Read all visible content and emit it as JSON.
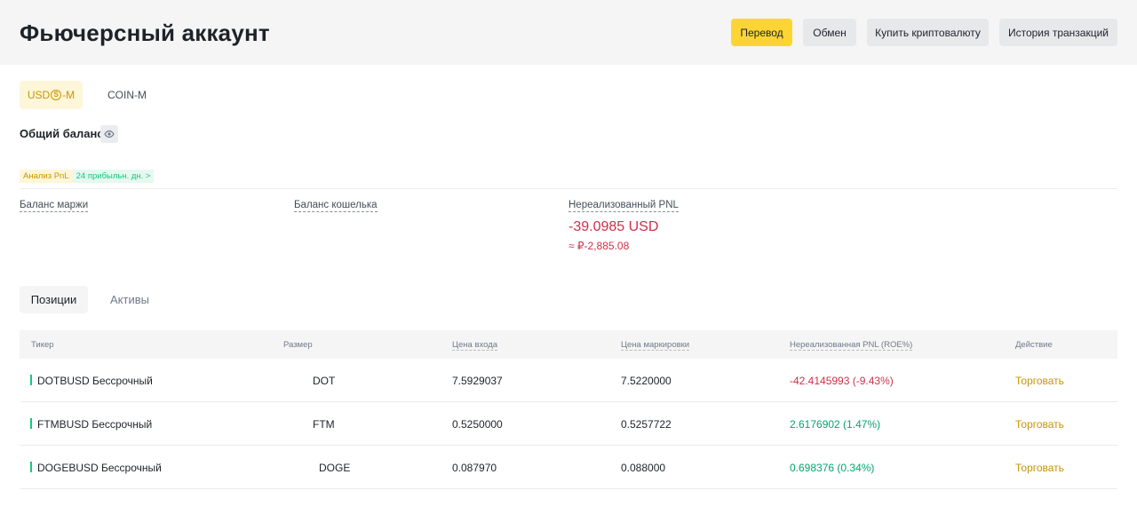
{
  "header": {
    "title": "Фьючерсный аккаунт",
    "buttons": {
      "transfer": "Перевод",
      "exchange": "Обмен",
      "buy_crypto": "Купить криптовалюту",
      "history": "История транзакций"
    }
  },
  "account_tabs": {
    "usd_pre": "USD",
    "usd_coin_glyph": "S",
    "usd_post": "-M",
    "coin": "COIN-M"
  },
  "balance": {
    "label": "Общий баланс",
    "pnl_analysis": "Анализ PnL",
    "profit_days": "24 прибыльн. дн. >"
  },
  "stats": {
    "margin_balance": "Баланс маржи",
    "wallet_balance": "Баланс кошелька",
    "unrealized_pnl": "Нереализованный PNL",
    "unrealized_value": "-39.0985 USD",
    "unrealized_approx": "≈ ₽-2,885.08"
  },
  "position_tabs": {
    "positions": "Позиции",
    "assets": "Активы"
  },
  "table": {
    "headers": {
      "ticker": "Тикер",
      "size": "Размер",
      "entry_price": "Цена входа",
      "mark_price": "Цена маркировки",
      "pnl": "Нереализованная PNL (ROE%)",
      "action": "Действие"
    },
    "rows": [
      {
        "ticker": "DOTBUSD Бессрочный",
        "size": "DOT",
        "entry": "7.5929037",
        "mark": "7.5220000",
        "pnl": "-42.4145993 (-9.43%)",
        "action": "Торговать"
      },
      {
        "ticker": "FTMBUSD Бессрочный",
        "size": "FTM",
        "entry": "0.5250000",
        "mark": "0.5257722",
        "pnl": "2.6176902 (1.47%)",
        "action": "Торговать"
      },
      {
        "ticker": "DOGEBUSD Бессрочный",
        "size": "DOGE",
        "entry": "0.087970",
        "mark": "0.088000",
        "pnl": "0.698376 (0.34%)",
        "action": "Торговать"
      }
    ]
  },
  "colors": {
    "brand": "#fcd535",
    "negative": "#cf304a",
    "positive": "#03a66d",
    "accent": "#c99400"
  }
}
